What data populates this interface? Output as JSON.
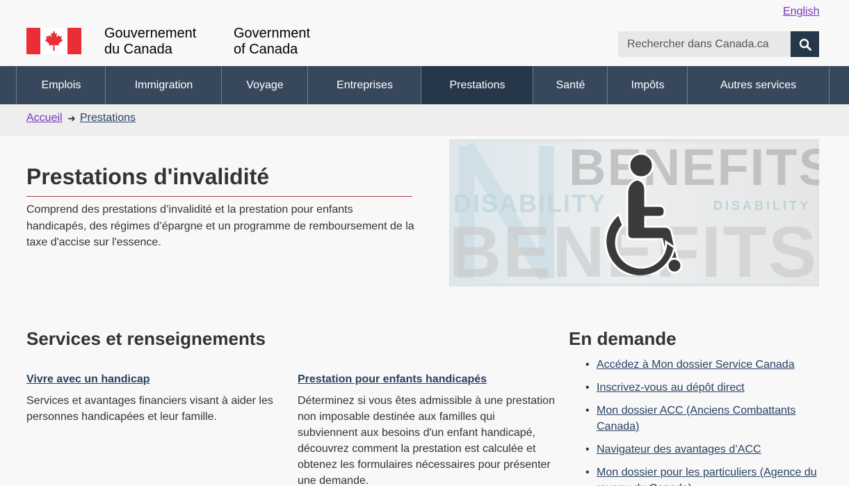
{
  "header": {
    "language_toggle": "English",
    "signature_fr": [
      "Gouvernement",
      "du Canada"
    ],
    "signature_en": [
      "Government",
      "of Canada"
    ],
    "search_placeholder": "Rechercher dans Canada.ca",
    "search_icon": "search-icon",
    "brand_color": "#eb2d37"
  },
  "menu": {
    "items": [
      {
        "label": "Emplois"
      },
      {
        "label": "Immigration"
      },
      {
        "label": "Voyage"
      },
      {
        "label": "Entreprises"
      },
      {
        "label": "Prestations",
        "active": true
      },
      {
        "label": "Santé"
      },
      {
        "label": "Impôts"
      },
      {
        "label": "Autres services"
      }
    ],
    "bg_color": "#38485c",
    "active_color": "#26374a"
  },
  "breadcrumb": {
    "home": "Accueil",
    "current": "Prestations"
  },
  "intro": {
    "title": "Prestations d'invalidité",
    "description": "Comprend des prestations d’invalidité et la prestation pour enfants handicapés, des régimes d’épargne et un programme de remboursement de la taxe d'accise sur l'essence.",
    "hero_words": {
      "benefits_top": "BENEFITS",
      "benefits_bottom": "BENEFITS",
      "disability_left": "DISABILITY",
      "disability_right": "DISABILITY"
    },
    "hero_icon": "wheelchair-icon"
  },
  "services": {
    "heading": "Services et renseignements",
    "cards": [
      {
        "title": "Vivre avec un handicap",
        "description": "Services et avantages financiers visant à aider les personnes handicapées et leur famille."
      },
      {
        "title": "Prestation pour enfants handicapés",
        "description": "Déterminez si vous êtes admissible à une prestation non imposable destinée aux familles qui subviennent aux besoins d'un enfant handicapé, découvrez comment la prestation est calculée et obtenez les formulaires nécessaires pour présenter une demande."
      }
    ]
  },
  "in_demand": {
    "heading": "En demande",
    "links": [
      "Accédez à Mon dossier Service Canada",
      "Inscrivez-vous au dépôt direct",
      "Mon dossier ACC (Anciens Combattants Canada)",
      "Navigateur des avantages d’ACC",
      "Mon dossier pour les particuliers (Agence du revenu du Canada)"
    ]
  }
}
